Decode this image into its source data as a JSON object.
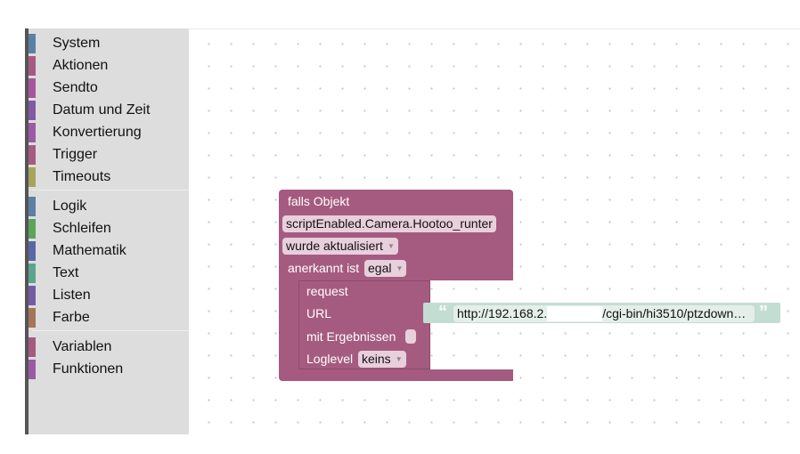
{
  "sidebar": {
    "categories": [
      {
        "label": "System",
        "color": "#5b80a5"
      },
      {
        "label": "Aktionen",
        "color": "#a55b80"
      },
      {
        "label": "Sendto",
        "color": "#a5569e"
      },
      {
        "label": "Datum und Zeit",
        "color": "#805ba5"
      },
      {
        "label": "Konvertierung",
        "color": "#9a5ba5"
      },
      {
        "label": "Trigger",
        "color": "#a55b80"
      },
      {
        "label": "Timeouts",
        "color": "#a5a55b"
      },
      {
        "label": "Logik",
        "color": "#5b80a5"
      },
      {
        "label": "Schleifen",
        "color": "#5ba55b"
      },
      {
        "label": "Mathematik",
        "color": "#5b67a5"
      },
      {
        "label": "Text",
        "color": "#5ba58c"
      },
      {
        "label": "Listen",
        "color": "#745ba5"
      },
      {
        "label": "Farbe",
        "color": "#a5745b"
      },
      {
        "label": "Variablen",
        "color": "#a55b80"
      },
      {
        "label": "Funktionen",
        "color": "#9a5ba5"
      }
    ]
  },
  "trigger_block": {
    "title": "falls Objekt",
    "object_id": "scriptEnabled.Camera.Hootoo_runter",
    "condition": "wurde aktualisiert",
    "ack_label": "anerkannt ist",
    "ack_value": "egal"
  },
  "request_block": {
    "title": "request",
    "url_label": "URL",
    "results_label": "mit Ergebnissen",
    "loglevel_label": "Loglevel",
    "loglevel_value": "keins"
  },
  "text_block": {
    "open_quote": "“",
    "value_start": "http://192.168.2.",
    "value_end": "/cgi-bin/hi3510/ptzdown…",
    "close_quote": "”"
  }
}
